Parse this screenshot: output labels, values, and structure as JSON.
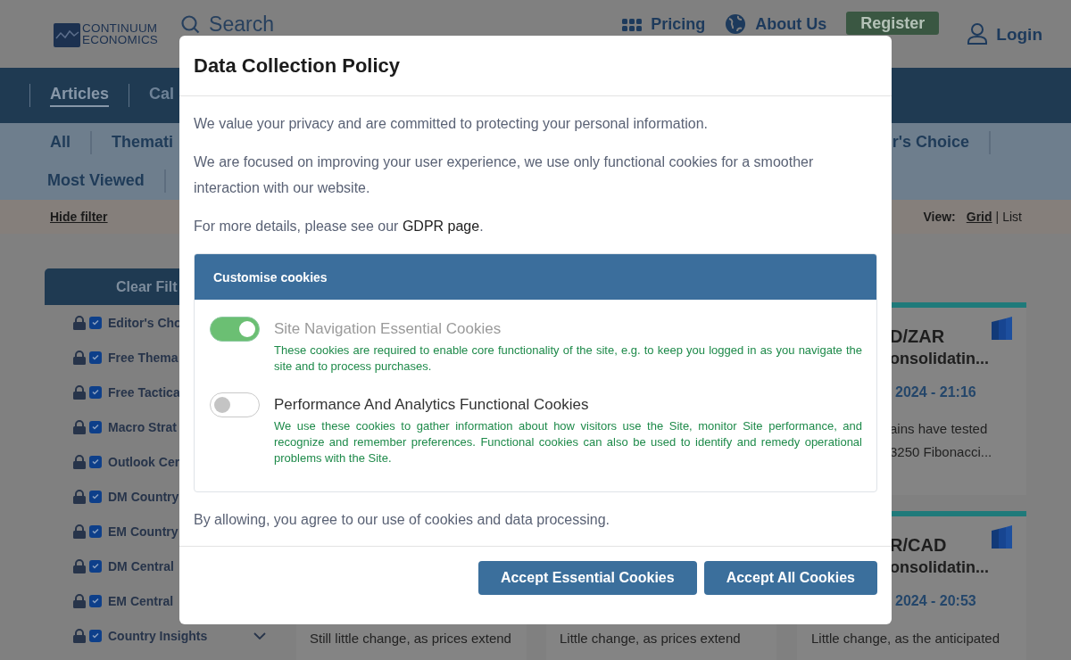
{
  "header": {
    "logo_lines": [
      "CONTINUUM",
      "ECONOMICS"
    ],
    "search_placeholder": "Search",
    "links": [
      {
        "label": "Pricing",
        "kind": "grid"
      },
      {
        "label": "About Us",
        "kind": "globe"
      }
    ],
    "register": "Register",
    "login": "Login"
  },
  "nav": {
    "tabs": [
      {
        "label": "Articles",
        "selected": true
      },
      {
        "label": "Cal",
        "selected": false
      }
    ]
  },
  "filters": {
    "row_1_left": [
      {
        "label": "All"
      },
      {
        "label": "Themati"
      }
    ],
    "row_1_right": [
      {
        "label": "r's Choice"
      }
    ],
    "row_2": [
      {
        "label": "Most Viewed"
      }
    ]
  },
  "filter_bar": {
    "hide_filter": "Hide filter",
    "view_label": "View:",
    "views": [
      {
        "label": "Grid",
        "selected": true
      },
      {
        "label": "List",
        "selected": false
      }
    ],
    "view_separator": "|"
  },
  "sidebar": {
    "clear_button": "Clear Filt",
    "items": [
      {
        "label": "Editor's Cho",
        "locked": true,
        "checked": true
      },
      {
        "label": "Free Thema",
        "locked": true,
        "checked": true
      },
      {
        "label": "Free Tactica",
        "locked": true,
        "checked": true
      },
      {
        "label": "Macro Strat",
        "locked": true,
        "checked": true
      },
      {
        "label": "Outlook Cer",
        "locked": true,
        "checked": true
      },
      {
        "label": "DM Country",
        "locked": true,
        "checked": true
      },
      {
        "label": "EM Country",
        "locked": true,
        "checked": true
      },
      {
        "label": "DM Central",
        "locked": true,
        "checked": true
      },
      {
        "label": "EM Central",
        "locked": true,
        "checked": true
      },
      {
        "label": "Country Insights",
        "locked": true,
        "checked": true,
        "expandable": true
      }
    ]
  },
  "columns": [
    {
      "cards": [
        {
          "summary": "Still little change, as prices extend"
        }
      ]
    },
    {
      "cards": [
        {
          "summary": "Little change, as prices extend"
        }
      ]
    },
    {
      "cards": [
        {
          "title": "D/ZAR",
          "subtitle": "onsolidatin...",
          "date": "2024 - 21:16",
          "summary": "ains have tested 3250 Fibonacci..."
        },
        {
          "title": "R/CAD",
          "subtitle": "onsolidatin...",
          "date": "2024 - 20:53",
          "summary": "Little change, as the anticipated"
        }
      ]
    }
  ],
  "dialog": {
    "title": "Data Collection Policy",
    "paragraphs": [
      "We value your privacy and are committed to protecting your personal information.",
      "We are focused on improving your user experience, we use only functional cookies for a smoother interaction with our website."
    ],
    "details": {
      "before": "For more details, please see our ",
      "link": "GDPR page",
      "after": "."
    },
    "customise_title": "Customise cookies",
    "options": [
      {
        "name": "Site Navigation Essential Cookies",
        "description": "These cookies are required to enable core functionality of the site, e.g. to keep you logged in as you navigate the site and to process purchases.",
        "on": true,
        "disabled": true
      },
      {
        "name": "Performance And Analytics Functional Cookies",
        "description": "We use these cookies to gather information about how visitors use the Site, monitor Site performance, and recognize and remember preferences. Functional cookies can also be used to identify and remedy operational problems with the Site.",
        "on": false,
        "disabled": false
      }
    ],
    "consent_note": "By allowing, you agree to our use of cookies and data processing.",
    "buttons": [
      "Accept Essential Cookies",
      "Accept All Cookies"
    ]
  }
}
